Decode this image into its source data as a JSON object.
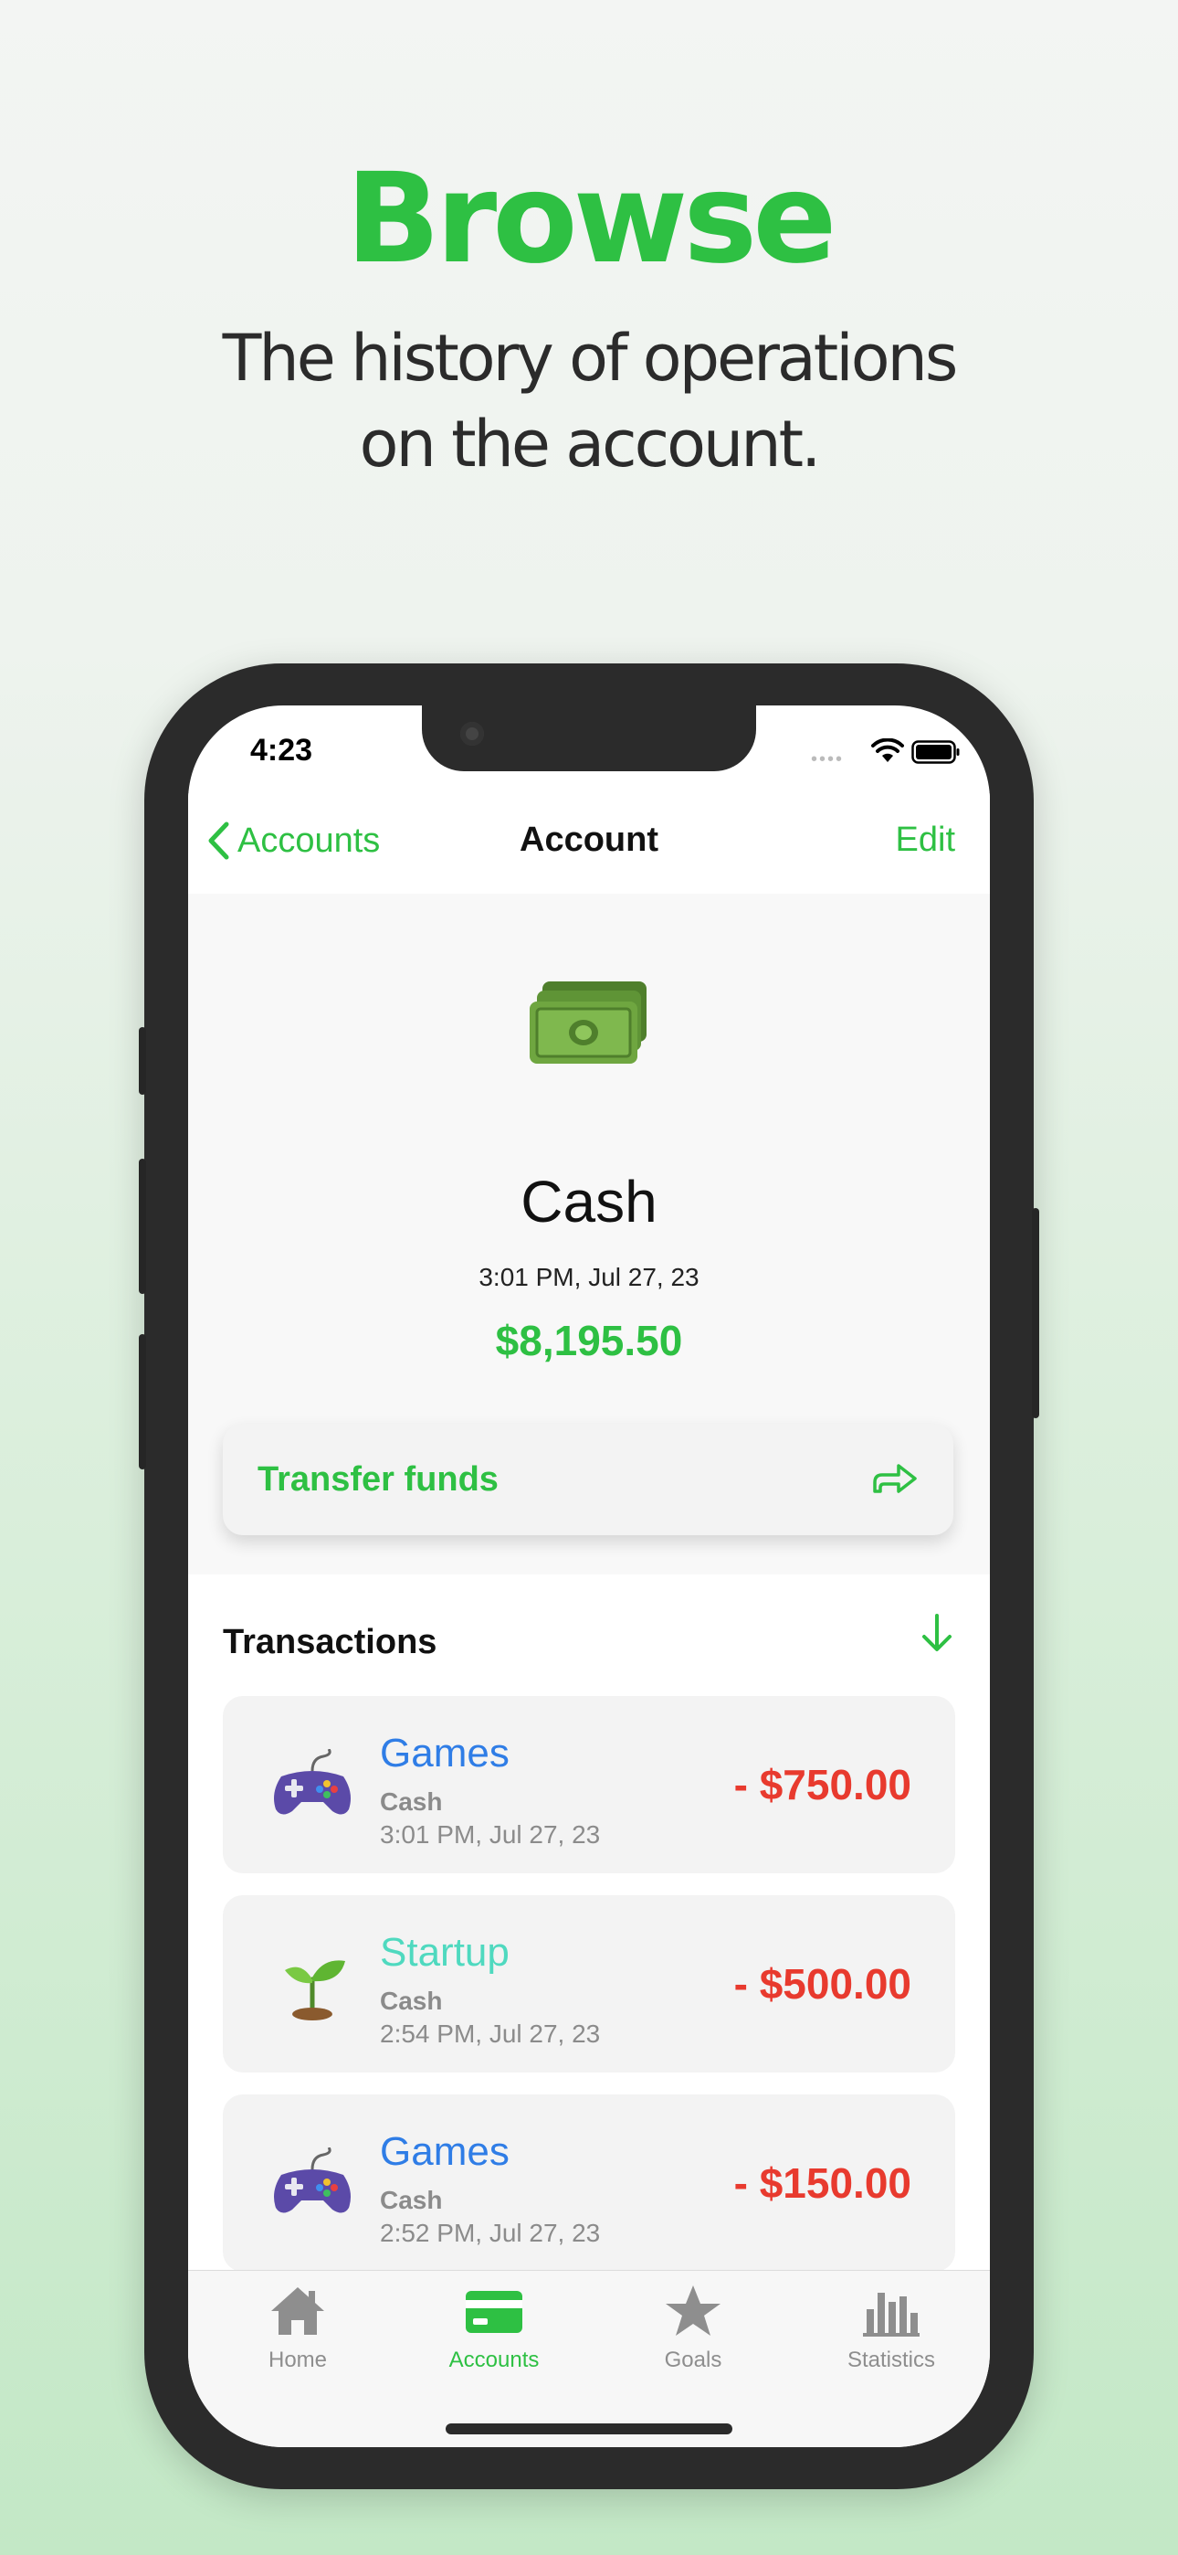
{
  "promo": {
    "headline": "Browse",
    "subline_1": "The history of operations",
    "subline_2": "on the account."
  },
  "status_bar": {
    "time": "4:23",
    "icons": [
      "signal-dots-icon",
      "wifi-icon",
      "battery-icon"
    ]
  },
  "navbar": {
    "back_label": "Accounts",
    "title": "Account",
    "edit_label": "Edit"
  },
  "account": {
    "icon": "money-bills-icon",
    "name": "Cash",
    "date": "3:01 PM, Jul 27, 23",
    "balance": "$8,195.50"
  },
  "transfer": {
    "label": "Transfer funds",
    "icon": "share-arrow-icon"
  },
  "transactions": {
    "header": "Transactions",
    "sort_icon": "arrow-down-icon",
    "items": [
      {
        "icon": "gamepad-icon",
        "title": "Games",
        "title_color": "#2f7de6",
        "account": "Cash",
        "date": "3:01 PM, Jul 27, 23",
        "amount": "- $750.00"
      },
      {
        "icon": "seedling-icon",
        "title": "Startup",
        "title_color": "#4fd9bf",
        "account": "Cash",
        "date": "2:54 PM, Jul 27, 23",
        "amount": "- $500.00"
      },
      {
        "icon": "gamepad-icon",
        "title": "Games",
        "title_color": "#2f7de6",
        "account": "Cash",
        "date": "2:52 PM, Jul 27, 23",
        "amount": "- $150.00"
      }
    ]
  },
  "tabbar": {
    "tabs": [
      {
        "label": "Home",
        "icon": "house-icon",
        "active": false
      },
      {
        "label": "Accounts",
        "icon": "card-icon",
        "active": true
      },
      {
        "label": "Goals",
        "icon": "star-icon",
        "active": false
      },
      {
        "label": "Statistics",
        "icon": "bar-chart-icon",
        "active": false
      }
    ]
  },
  "colors": {
    "accent": "#2ec043",
    "negative": "#e83a2e",
    "muted": "#8e8e8e"
  }
}
